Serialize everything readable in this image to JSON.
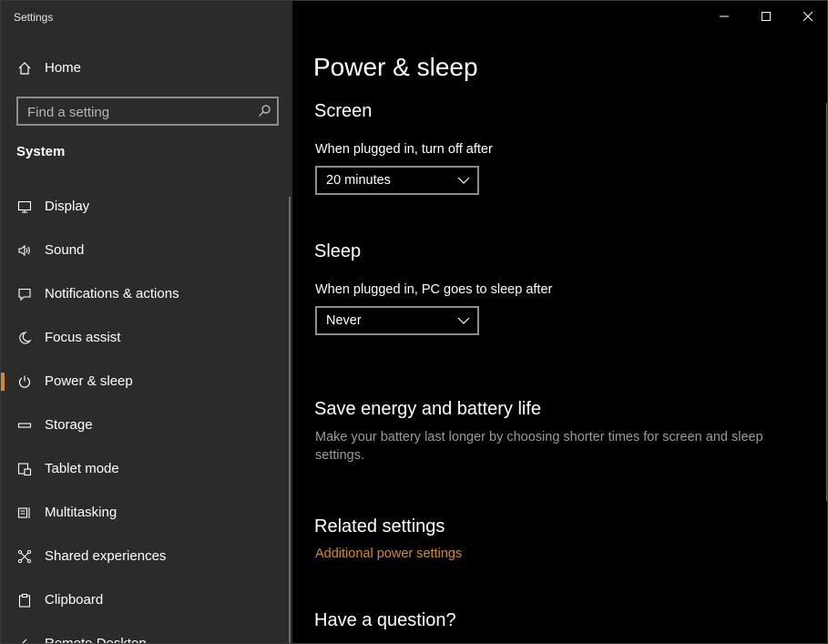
{
  "window": {
    "title": "Settings",
    "controls": [
      "minimize",
      "maximize",
      "close"
    ]
  },
  "sidebar": {
    "home_label": "Home",
    "search": {
      "placeholder": "Find a setting",
      "value": ""
    },
    "section_label": "System",
    "items": [
      {
        "label": "Display",
        "icon": "display-icon",
        "active": false
      },
      {
        "label": "Sound",
        "icon": "sound-icon",
        "active": false
      },
      {
        "label": "Notifications & actions",
        "icon": "notifications-icon",
        "active": false
      },
      {
        "label": "Focus assist",
        "icon": "moon-icon",
        "active": false
      },
      {
        "label": "Power & sleep",
        "icon": "power-icon",
        "active": true
      },
      {
        "label": "Storage",
        "icon": "storage-icon",
        "active": false
      },
      {
        "label": "Tablet mode",
        "icon": "tablet-icon",
        "active": false
      },
      {
        "label": "Multitasking",
        "icon": "multitasking-icon",
        "active": false
      },
      {
        "label": "Shared experiences",
        "icon": "shared-icon",
        "active": false
      },
      {
        "label": "Clipboard",
        "icon": "clipboard-icon",
        "active": false
      },
      {
        "label": "Remote Desktop",
        "icon": "remote-desktop-icon",
        "active": false
      }
    ]
  },
  "main": {
    "title": "Power & sleep",
    "screen": {
      "heading": "Screen",
      "label": "When plugged in, turn off after",
      "value": "20 minutes"
    },
    "sleep": {
      "heading": "Sleep",
      "label": "When plugged in, PC goes to sleep after",
      "value": "Never"
    },
    "save_energy": {
      "heading": "Save energy and battery life",
      "description": "Make your battery last longer by choosing shorter times for screen and sleep settings."
    },
    "related": {
      "heading": "Related settings",
      "link": "Additional power settings"
    },
    "question": {
      "heading": "Have a question?"
    }
  },
  "colors": {
    "accent": "#d48a2b",
    "sidebar_bg": "#2b2b2b",
    "main_bg": "#000000",
    "muted_text": "#9a9a9a"
  }
}
